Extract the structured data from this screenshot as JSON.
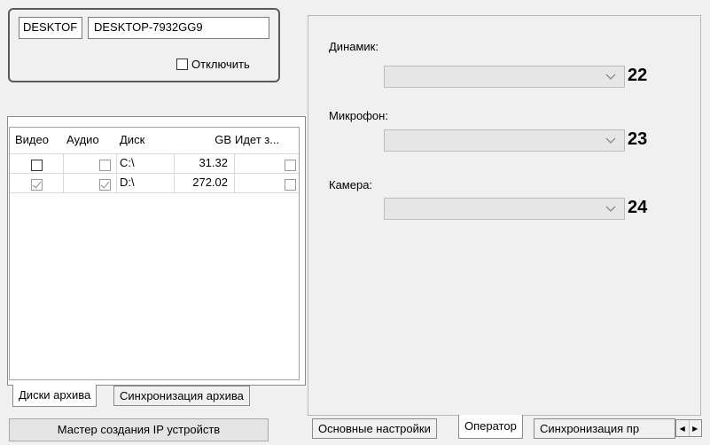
{
  "host": {
    "short_name": "DESKTOF",
    "full_name": "DESKTOP-7932GG9",
    "disable_label": "Отключить"
  },
  "disk_table": {
    "columns": [
      "Видео",
      "Аудио",
      "Диск",
      "GB",
      "Идет з..."
    ],
    "rows": [
      {
        "video": false,
        "audio": false,
        "disk": "C:\\",
        "gb": "31.32",
        "writing": false
      },
      {
        "video": true,
        "audio": true,
        "disk": "D:\\",
        "gb": "272.02",
        "writing": false
      }
    ]
  },
  "left_tabs": {
    "archive_disks": "Диски архива",
    "archive_sync": "Синхронизация архива"
  },
  "wizard_button": "Мастер создания IP устройств",
  "operator": {
    "speaker_label": "Динамик:",
    "speaker_callout": "22",
    "mic_label": "Микрофон:",
    "mic_callout": "23",
    "camera_label": "Камера:",
    "camera_callout": "24"
  },
  "right_tabs": {
    "main_settings": "Основные настройки",
    "operator": "Оператор",
    "sync": "Синхронизация пр"
  }
}
